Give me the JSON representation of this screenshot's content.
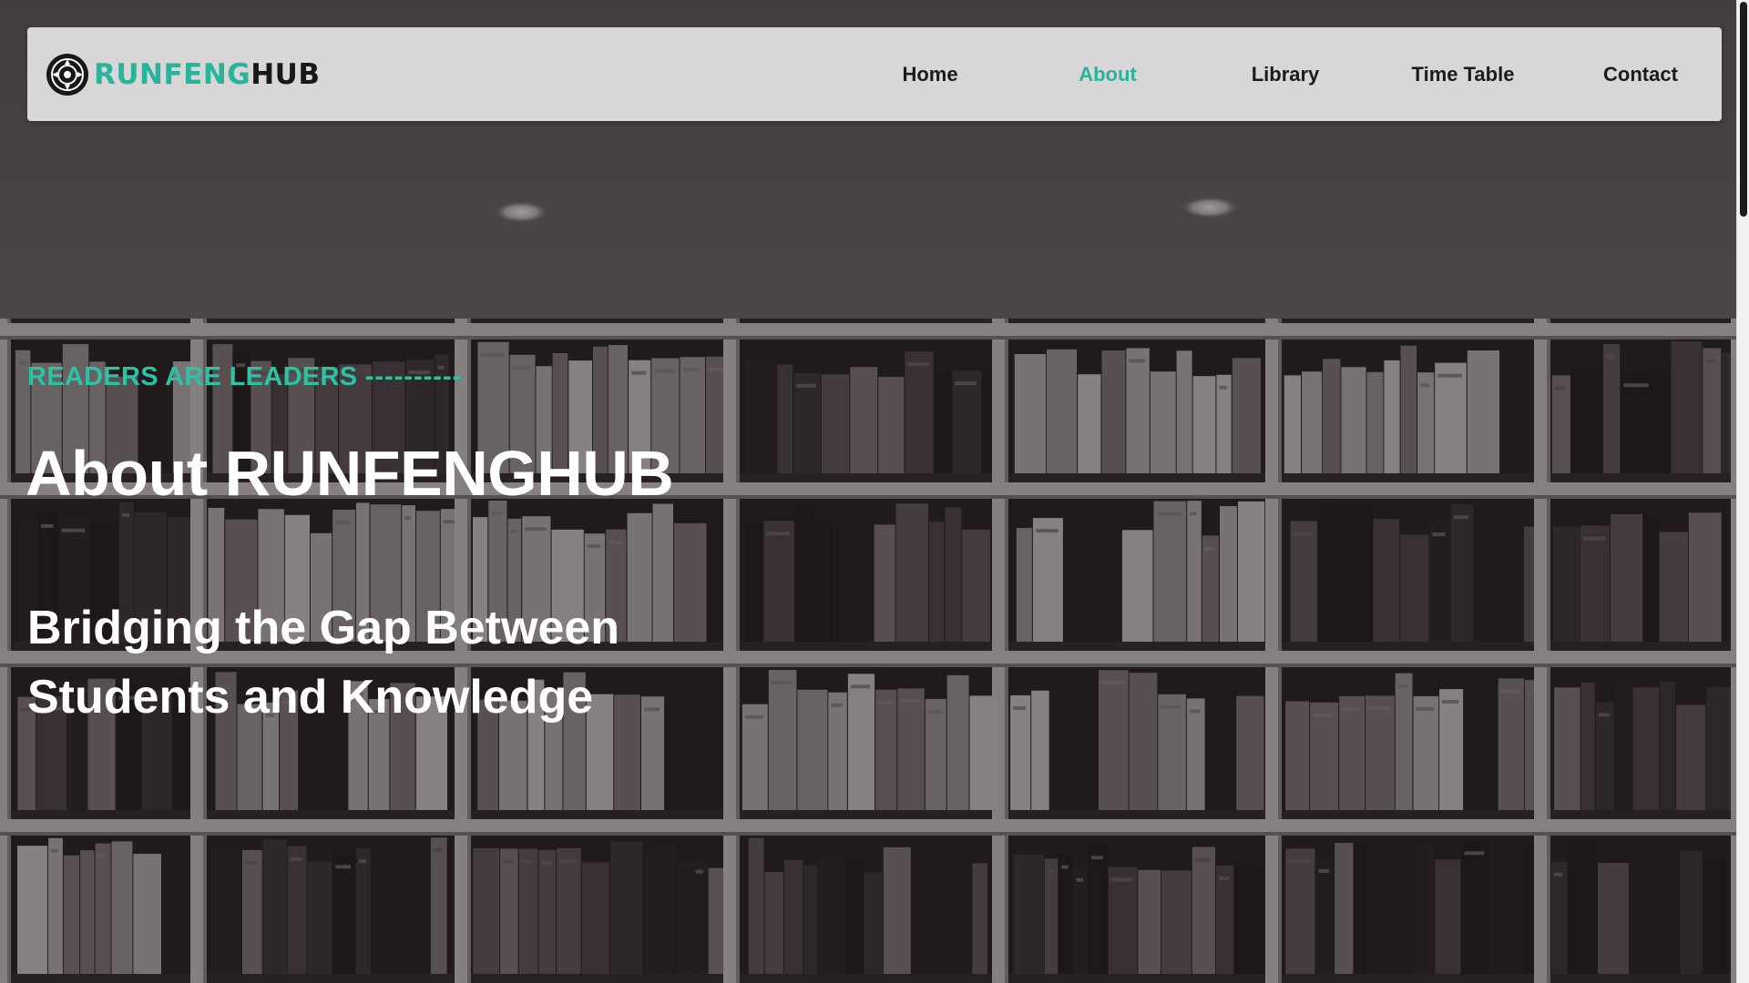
{
  "brand": {
    "name_part1": "RUNFENG",
    "name_part2": "HUB",
    "logo_icon": "compass-emblem-icon",
    "accent_color": "#28b39b",
    "dark_color": "#1b1719"
  },
  "nav": {
    "items": [
      {
        "label": "Home",
        "active": false
      },
      {
        "label": "About",
        "active": true
      },
      {
        "label": "Library",
        "active": false
      },
      {
        "label": "Time Table",
        "active": false
      },
      {
        "label": "Contact",
        "active": false
      }
    ]
  },
  "hero": {
    "eyebrow": "READERS ARE LEADERS",
    "eyebrow_dashes": "----------",
    "title": "About RUNFENGHUB",
    "tagline_line1": "Bridging the Gap Between",
    "tagline_line2": "Students and Knowledge",
    "background": "bookshelf-photo-darkened"
  }
}
